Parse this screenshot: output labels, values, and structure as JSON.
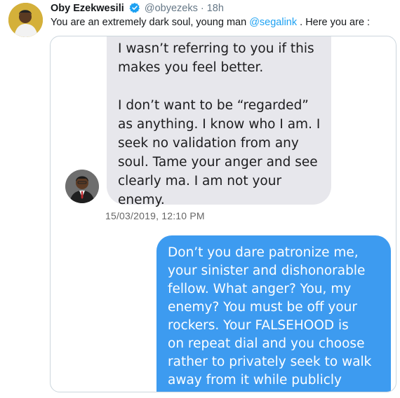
{
  "tweet": {
    "display_name": "Oby Ezekwesili",
    "handle": "@obyezeks",
    "separator": "·",
    "time": "18h",
    "text_before": "You are an extremely dark soul, young man ",
    "mention": "@segalink",
    "text_after": " . Here you are :"
  },
  "screenshot": {
    "received_message": [
      "I wasn’t referring to you if this\nmakes you feel better.",
      "I don’t want to be “regarded”\nas anything. I know who I am. I\nseek no validation from any\nsoul. Tame your anger and see\nclearly ma. I am not your\nenemy."
    ],
    "timestamp": "15/03/2019, 12:10 PM",
    "sent_message": "Don’t you dare patronize me,\nyour sinister and dishonorable\nfellow. What anger? You, my\nenemy? You must be off your\nrockers. Your FALSEHOOD is\non repeat dial and you choose\nrather to privately seek to walk\naway from it while publicly"
  },
  "colors": {
    "link": "#1da1f2",
    "verified": "#1da1f2",
    "sent_bubble": "#3d9bf0",
    "received_bubble": "#e7e7ec"
  },
  "icons": {
    "verified": "verified-badge-icon"
  }
}
